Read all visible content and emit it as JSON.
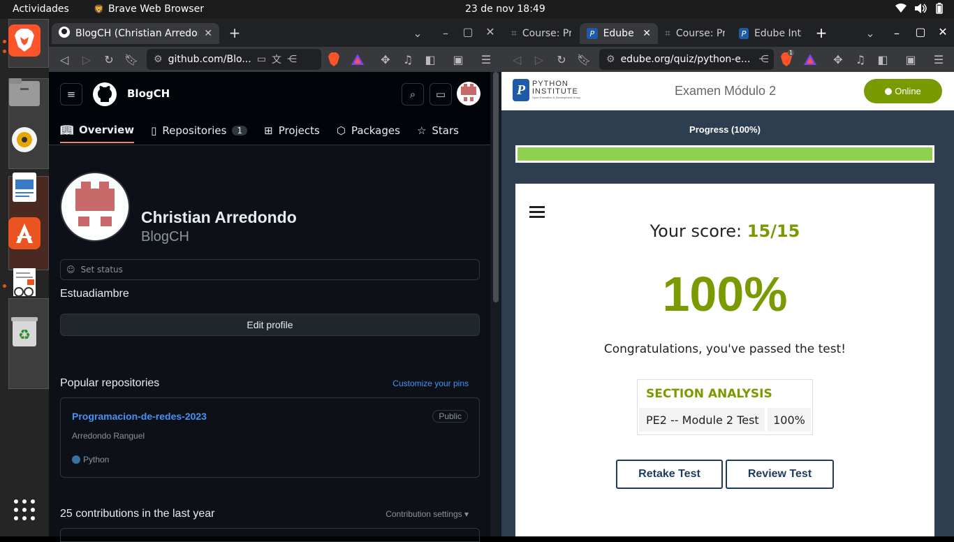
{
  "topbar": {
    "activities": "Actividades",
    "app_name": "Brave Web Browser",
    "datetime": "23 de nov  18:49"
  },
  "left_browser": {
    "tab_title": "BlogCH (Christian Arredondo)",
    "url": "github.com/Blo...",
    "github": {
      "logo_name": "BlogCH",
      "nav": [
        {
          "label": "Overview"
        },
        {
          "label": "Repositories",
          "count": "1"
        },
        {
          "label": "Projects"
        },
        {
          "label": "Packages"
        },
        {
          "label": "Stars"
        }
      ],
      "profile_name": "Christian Arredondo",
      "profile_login": "BlogCH",
      "set_status": "Set status",
      "bio": "Estuadiambre",
      "edit_profile": "Edit profile",
      "popular_title": "Popular repositories",
      "customize_pins": "Customize your pins",
      "repo_name": "Programacion-de-redes-2023",
      "repo_visibility": "Public",
      "repo_desc": "Arredondo Ranguel",
      "repo_lang": "Python",
      "contrib_title": "25 contributions in the last year",
      "contrib_settings": "Contribution settings"
    }
  },
  "right_browser": {
    "tabs": [
      {
        "title": "Course: Pr"
      },
      {
        "title": "Edube"
      },
      {
        "title": "Course: Pr"
      },
      {
        "title": "Edube Inte"
      }
    ],
    "url": "edube.org/quiz/python-e...",
    "brave_badge": "1",
    "edube": {
      "logo_line1": "PYTHON",
      "logo_line2": "INSTITUTE",
      "logo_line3": "Open Education & Development Group",
      "exam_title": "Examen Módulo 2",
      "online_label": "Online",
      "progress_label": "Progress (100%)",
      "progress_fraction": 1.0,
      "score_label": "Your score:",
      "score_value": "15/15",
      "percent": "100%",
      "congrats": "Congratulations, you've passed the test!",
      "section_title": "SECTION ANALYSIS",
      "section_row_name": "PE2 -- Module 2 Test",
      "section_row_value": "100%",
      "retake": "Retake Test",
      "review": "Review Test"
    }
  },
  "colors": {
    "accent_green": "#7a9a01",
    "progress_green": "#8fd14f",
    "edube_navy": "#2c3e50",
    "github_link": "#4493f8",
    "brave_orange": "#fb542b"
  }
}
